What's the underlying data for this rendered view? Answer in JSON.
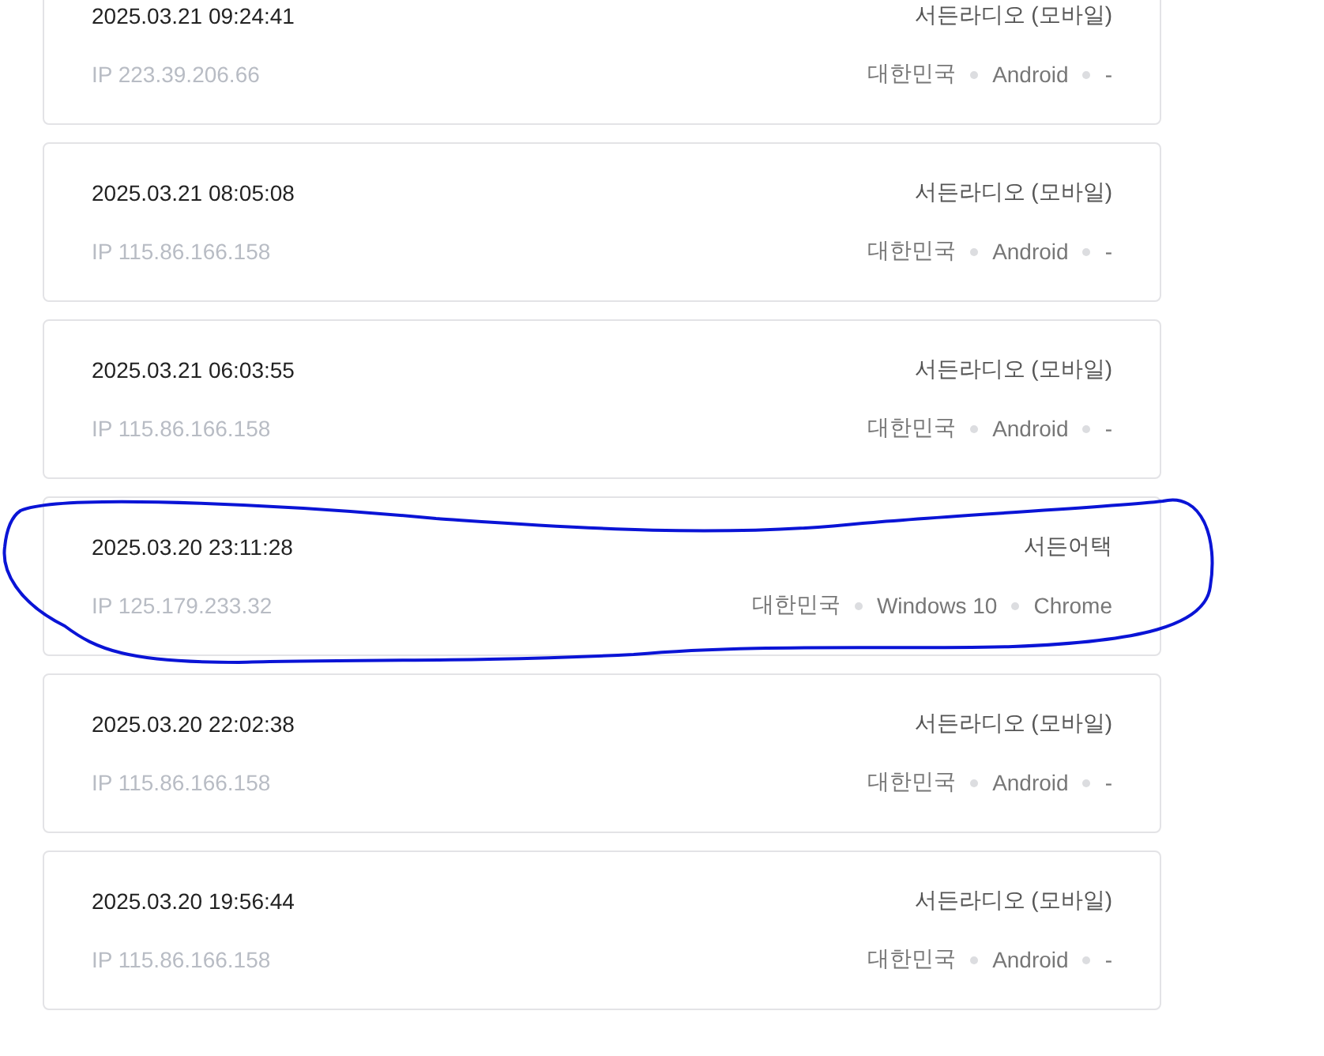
{
  "sessions": [
    {
      "time": "2025.03.21 09:24:41",
      "device": "서든라디오 (모바일)",
      "ip": "IP 223.39.206.66",
      "meta": [
        "대한민국",
        "Android",
        "-"
      ],
      "highlighted": false
    },
    {
      "time": "2025.03.21 08:05:08",
      "device": "서든라디오 (모바일)",
      "ip": "IP 115.86.166.158",
      "meta": [
        "대한민국",
        "Android",
        "-"
      ],
      "highlighted": false
    },
    {
      "time": "2025.03.21 06:03:55",
      "device": "서든라디오 (모바일)",
      "ip": "IP 115.86.166.158",
      "meta": [
        "대한민국",
        "Android",
        "-"
      ],
      "highlighted": false
    },
    {
      "time": "2025.03.20 23:11:28",
      "device": "서든어택",
      "ip": "IP 125.179.233.32",
      "meta": [
        "대한민국",
        "Windows 10",
        "Chrome"
      ],
      "highlighted": true
    },
    {
      "time": "2025.03.20 22:02:38",
      "device": "서든라디오 (모바일)",
      "ip": "IP 115.86.166.158",
      "meta": [
        "대한민국",
        "Android",
        "-"
      ],
      "highlighted": false
    },
    {
      "time": "2025.03.20 19:56:44",
      "device": "서든라디오 (모바일)",
      "ip": "IP 115.86.166.158",
      "meta": [
        "대한민국",
        "Android",
        "-"
      ],
      "highlighted": false
    }
  ]
}
